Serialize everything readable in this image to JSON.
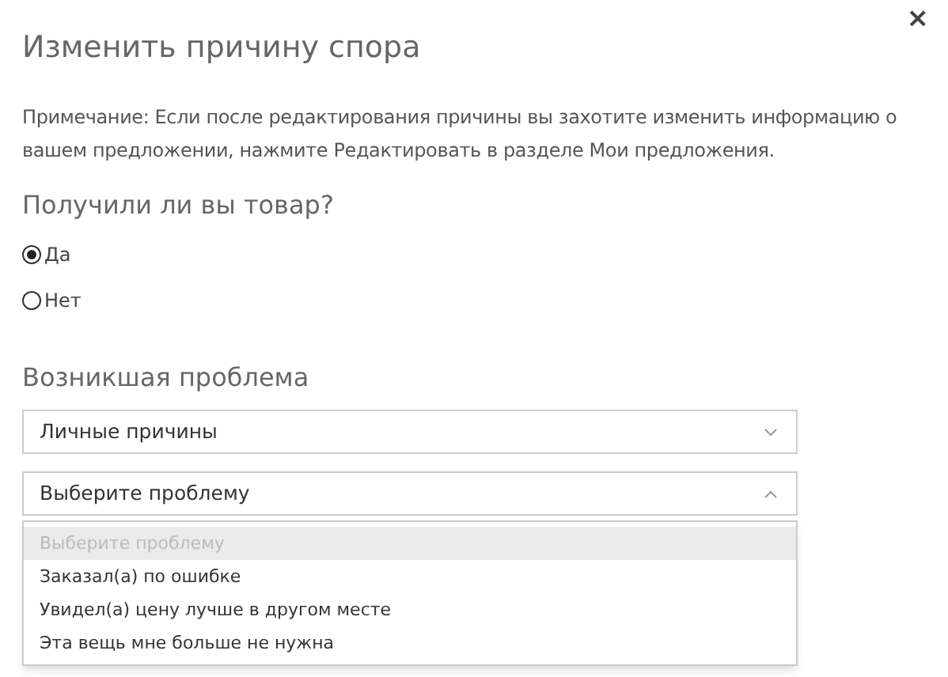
{
  "dialog": {
    "title": "Изменить причину спора",
    "close": "×",
    "note": "Примечание: Если после редактирования причины вы захотите изменить информацию о вашем предложении, нажмите Редактировать в разделе Мои предложения.",
    "question": "Получили ли вы товар?",
    "radios": [
      {
        "label": "Да",
        "selected": true
      },
      {
        "label": "Нет",
        "selected": false
      }
    ],
    "problem_heading": "Возникшая проблема",
    "selects": [
      {
        "value": "Личные причины",
        "expanded": false
      },
      {
        "value": "Выберите проблему",
        "expanded": true
      }
    ],
    "options": [
      {
        "label": "Выберите проблему",
        "disabled": true,
        "selected": true
      },
      {
        "label": "Заказал(а) по ошибке",
        "disabled": false,
        "selected": false
      },
      {
        "label": "Увидел(а) цену лучше в другом месте",
        "disabled": false,
        "selected": false
      },
      {
        "label": "Эта вещь мне больше не нужна",
        "disabled": false,
        "selected": false
      }
    ]
  }
}
